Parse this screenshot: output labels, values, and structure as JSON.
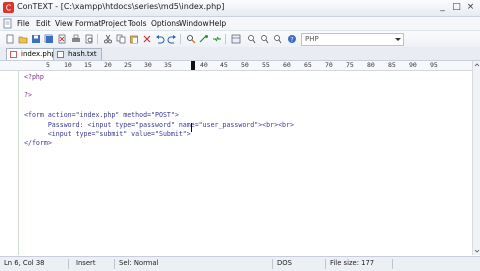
{
  "window": {
    "title": "ConTEXT - [C:\\xampp\\htdocs\\series\\md5\\index.php]",
    "controls": [
      "_",
      "□",
      "×"
    ]
  },
  "menubar": {
    "items": [
      "File",
      "Edit",
      "View",
      "Format",
      "Project",
      "Tools",
      "Options",
      "Window",
      "Help"
    ]
  },
  "toolbar": {
    "highlighter_value": "PHP"
  },
  "tabs": [
    {
      "label": "index.php",
      "active": true
    },
    {
      "label": "hash.txt",
      "active": false
    }
  ],
  "ruler": {
    "labels": [
      "5",
      "10",
      "15",
      "20",
      "25",
      "30",
      "35",
      "40",
      "45",
      "50",
      "55",
      "60",
      "65",
      "70",
      "75",
      "80",
      "85",
      "90",
      "95"
    ]
  },
  "editor": {
    "lines": [
      "<?php",
      "",
      "?>",
      "",
      "<form action=\"index.php\" method=\"POST\">",
      "      Password: <input type=\"password\" name=\"user_password\"><br><br>",
      "      <input type=\"submit\" value=\"Submit\">",
      "</form>"
    ]
  },
  "statusbar": {
    "position": "Ln 6, Col 38",
    "mode": "Insert",
    "selection": "Sel: Normal",
    "format": "DOS",
    "filesize": "File size: 177"
  }
}
